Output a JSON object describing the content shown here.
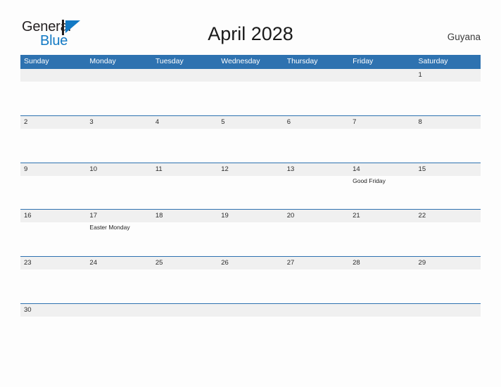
{
  "brand": {
    "name_part1": "General",
    "name_part2": "Blue",
    "flag_icon": "flag-triangle-icon",
    "accent_color": "#1279c4",
    "dark_color": "#231f20"
  },
  "header": {
    "title": "April 2028",
    "country": "Guyana"
  },
  "theme": {
    "header_blue": "#2e72b0",
    "row_divider_blue": "#2e72b0",
    "daynum_band_gray": "#f0f0f0",
    "page_background": "#fdfdfd"
  },
  "calendar": {
    "month": "April",
    "year": "2028",
    "weekday_headers": [
      "Sunday",
      "Monday",
      "Tuesday",
      "Wednesday",
      "Thursday",
      "Friday",
      "Saturday"
    ],
    "weeks": [
      {
        "days": [
          {
            "num": "",
            "events": []
          },
          {
            "num": "",
            "events": []
          },
          {
            "num": "",
            "events": []
          },
          {
            "num": "",
            "events": []
          },
          {
            "num": "",
            "events": []
          },
          {
            "num": "",
            "events": []
          },
          {
            "num": "1",
            "events": []
          }
        ]
      },
      {
        "days": [
          {
            "num": "2",
            "events": []
          },
          {
            "num": "3",
            "events": []
          },
          {
            "num": "4",
            "events": []
          },
          {
            "num": "5",
            "events": []
          },
          {
            "num": "6",
            "events": []
          },
          {
            "num": "7",
            "events": []
          },
          {
            "num": "8",
            "events": []
          }
        ]
      },
      {
        "days": [
          {
            "num": "9",
            "events": []
          },
          {
            "num": "10",
            "events": []
          },
          {
            "num": "11",
            "events": []
          },
          {
            "num": "12",
            "events": []
          },
          {
            "num": "13",
            "events": []
          },
          {
            "num": "14",
            "events": [
              "Good Friday"
            ]
          },
          {
            "num": "15",
            "events": []
          }
        ]
      },
      {
        "days": [
          {
            "num": "16",
            "events": []
          },
          {
            "num": "17",
            "events": [
              "Easter Monday"
            ]
          },
          {
            "num": "18",
            "events": []
          },
          {
            "num": "19",
            "events": []
          },
          {
            "num": "20",
            "events": []
          },
          {
            "num": "21",
            "events": []
          },
          {
            "num": "22",
            "events": []
          }
        ]
      },
      {
        "days": [
          {
            "num": "23",
            "events": []
          },
          {
            "num": "24",
            "events": []
          },
          {
            "num": "25",
            "events": []
          },
          {
            "num": "26",
            "events": []
          },
          {
            "num": "27",
            "events": []
          },
          {
            "num": "28",
            "events": []
          },
          {
            "num": "29",
            "events": []
          }
        ]
      },
      {
        "days": [
          {
            "num": "30",
            "events": []
          },
          {
            "num": "",
            "events": []
          },
          {
            "num": "",
            "events": []
          },
          {
            "num": "",
            "events": []
          },
          {
            "num": "",
            "events": []
          },
          {
            "num": "",
            "events": []
          },
          {
            "num": "",
            "events": []
          }
        ]
      }
    ]
  }
}
